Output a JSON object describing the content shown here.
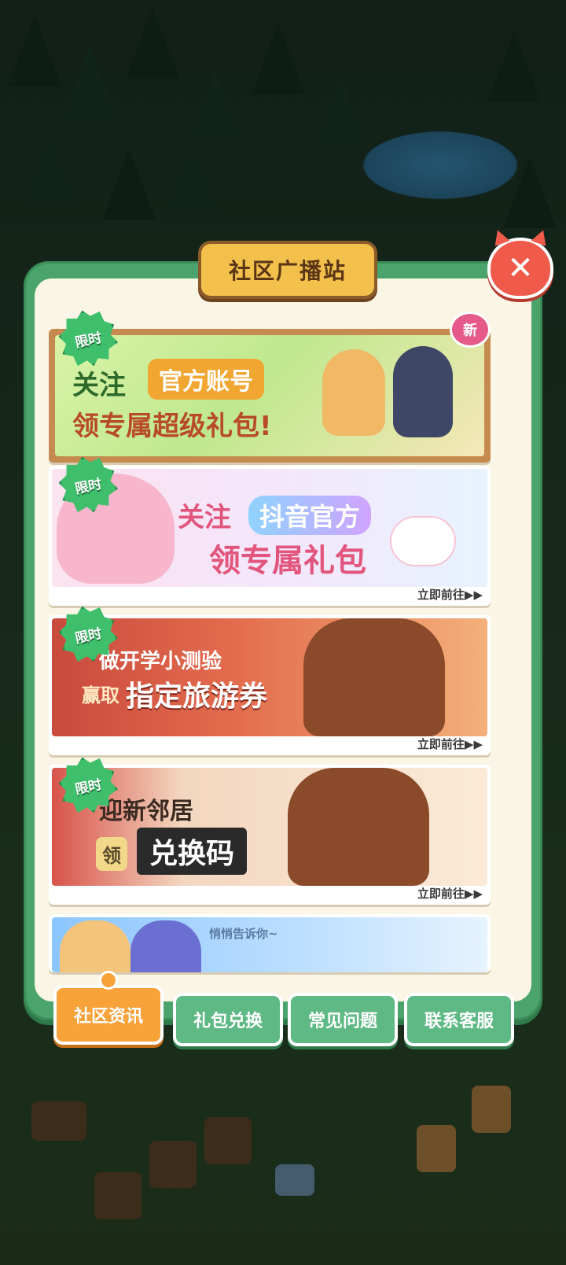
{
  "modal": {
    "title": "社区广播站",
    "close_label": "✕"
  },
  "banners": [
    {
      "tag": "限时",
      "line1": "关注",
      "highlight": "官方账号",
      "line2": "领专属超级礼包!",
      "badge": "新",
      "link": ""
    },
    {
      "tag": "限时",
      "line1": "关注",
      "highlight": "抖音官方",
      "line2": "领专属礼包",
      "badge": "",
      "link": "立即前往▶▶"
    },
    {
      "tag": "限时",
      "line1": "做开学小测验",
      "prefix": "赢取",
      "highlight": "指定旅游券",
      "link": "立即前往▶▶"
    },
    {
      "tag": "限时",
      "line1": "迎新邻居",
      "prefix": "领",
      "highlight": "兑换码",
      "link": "立即前往▶▶"
    },
    {
      "caption": "悄悄告诉你~"
    }
  ],
  "tabs": [
    {
      "label": "社区资讯",
      "active": true
    },
    {
      "label": "礼包兑换",
      "active": false
    },
    {
      "label": "常见问题",
      "active": false
    },
    {
      "label": "联系客服",
      "active": false
    }
  ],
  "colors": {
    "accent_green": "#4aa46b",
    "tab_active": "#f8a23a",
    "panel": "#fbf5e6"
  }
}
